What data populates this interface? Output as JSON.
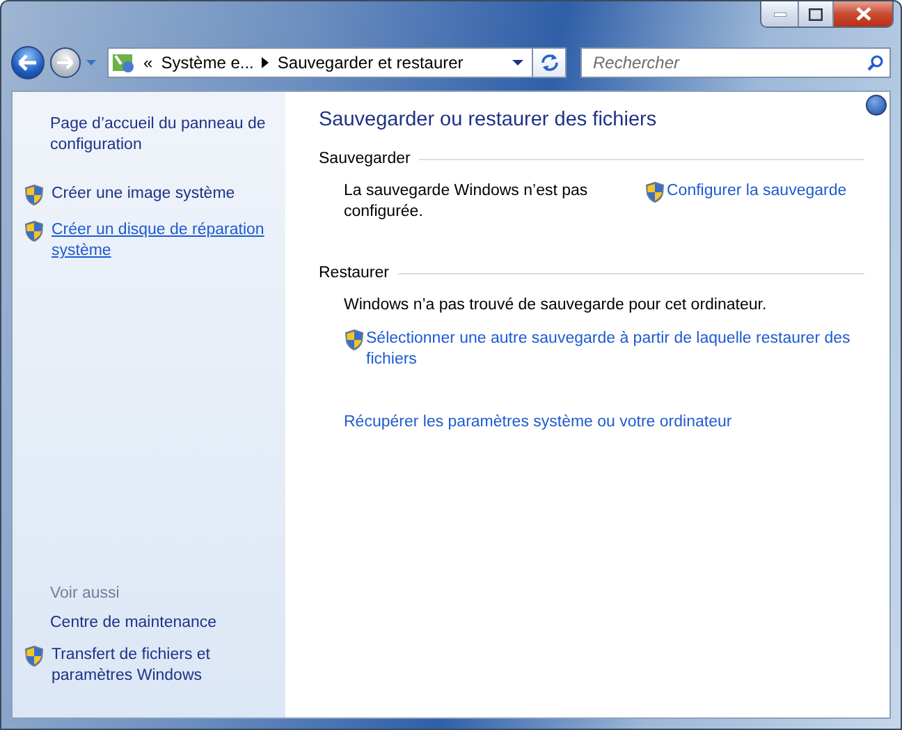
{
  "navigation": {
    "overflow": "«",
    "breadcrumb": [
      {
        "label": "Système e..."
      },
      {
        "label": "Sauvegarder et restaurer"
      }
    ],
    "search": {
      "placeholder": "Rechercher"
    }
  },
  "sidebar": {
    "items": [
      {
        "label": "Page d’accueil du panneau de configuration",
        "shield": false,
        "hovered": false
      },
      {
        "label": "Créer une image système",
        "shield": true,
        "hovered": false
      },
      {
        "label": "Créer un disque de réparation système",
        "shield": true,
        "hovered": true
      }
    ],
    "see_also": {
      "heading": "Voir aussi",
      "items": [
        {
          "label": "Centre de maintenance",
          "shield": false,
          "hovered": false
        },
        {
          "label": "Transfert de fichiers et paramètres Windows",
          "shield": true,
          "hovered": false
        }
      ]
    }
  },
  "main": {
    "title": "Sauvegarder ou restaurer des fichiers",
    "backup": {
      "heading": "Sauvegarder",
      "status": "La sauvegarde Windows n’est pas configurée.",
      "link": "Configurer la sauvegarde"
    },
    "restore": {
      "heading": "Restaurer",
      "status": "Windows n’a pas trouvé de sauvegarde pour cet ordinateur.",
      "link": "Sélectionner une autre sauvegarde à partir de laquelle restaurer des fichiers"
    },
    "recover_link": "Récupérer les paramètres système ou votre ordinateur"
  }
}
